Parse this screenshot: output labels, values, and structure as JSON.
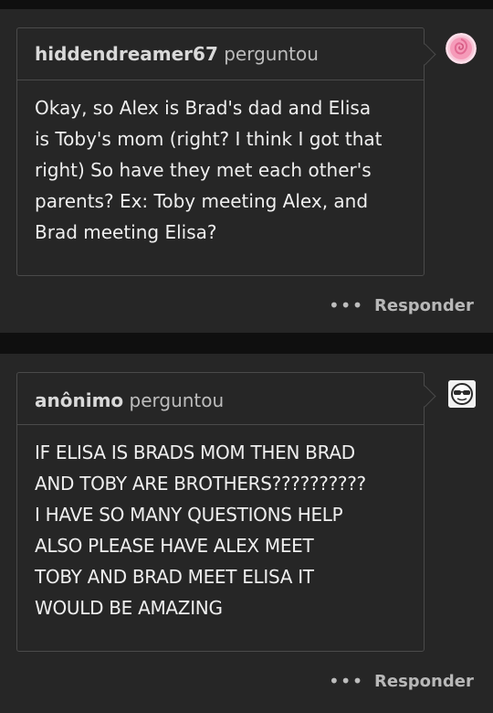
{
  "posts": [
    {
      "asker": "hiddendreamer67",
      "verb": "perguntou",
      "lines": [
        "Okay, so Alex is Brad's dad and Elisa",
        "is Toby's mom (right? I think I got that",
        "right) So have they met each other's",
        "parents? Ex: Toby meeting Alex, and",
        "Brad meeting Elisa?"
      ],
      "more": "•••",
      "reply": "Responder",
      "avatar_icon": "pink-rose-avatar"
    },
    {
      "asker": "anônimo",
      "verb": "perguntou",
      "lines": [
        "IF ELISA IS BRADS MOM THEN BRAD",
        "AND TOBY ARE BROTHERS??????????",
        "I HAVE SO MANY QUESTIONS HELP",
        "ALSO PLEASE HAVE ALEX MEET",
        "TOBY AND BRAD MEET ELISA IT",
        "WOULD BE AMAZING"
      ],
      "more": "•••",
      "reply": "Responder",
      "avatar_icon": "sunglasses-face-avatar"
    }
  ]
}
